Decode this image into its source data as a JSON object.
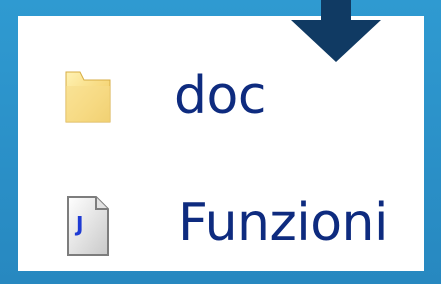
{
  "background": {
    "frame_color": "#2a8fc6",
    "panel_color": "#ffffff"
  },
  "arrow": {
    "icon": "arrow-down-icon",
    "color": "#103a63"
  },
  "files": [
    {
      "name": "doc",
      "icon": "folder-icon"
    },
    {
      "name": "Funzioni",
      "icon": "java-file-icon"
    }
  ],
  "text_color": "#0e2b7f"
}
